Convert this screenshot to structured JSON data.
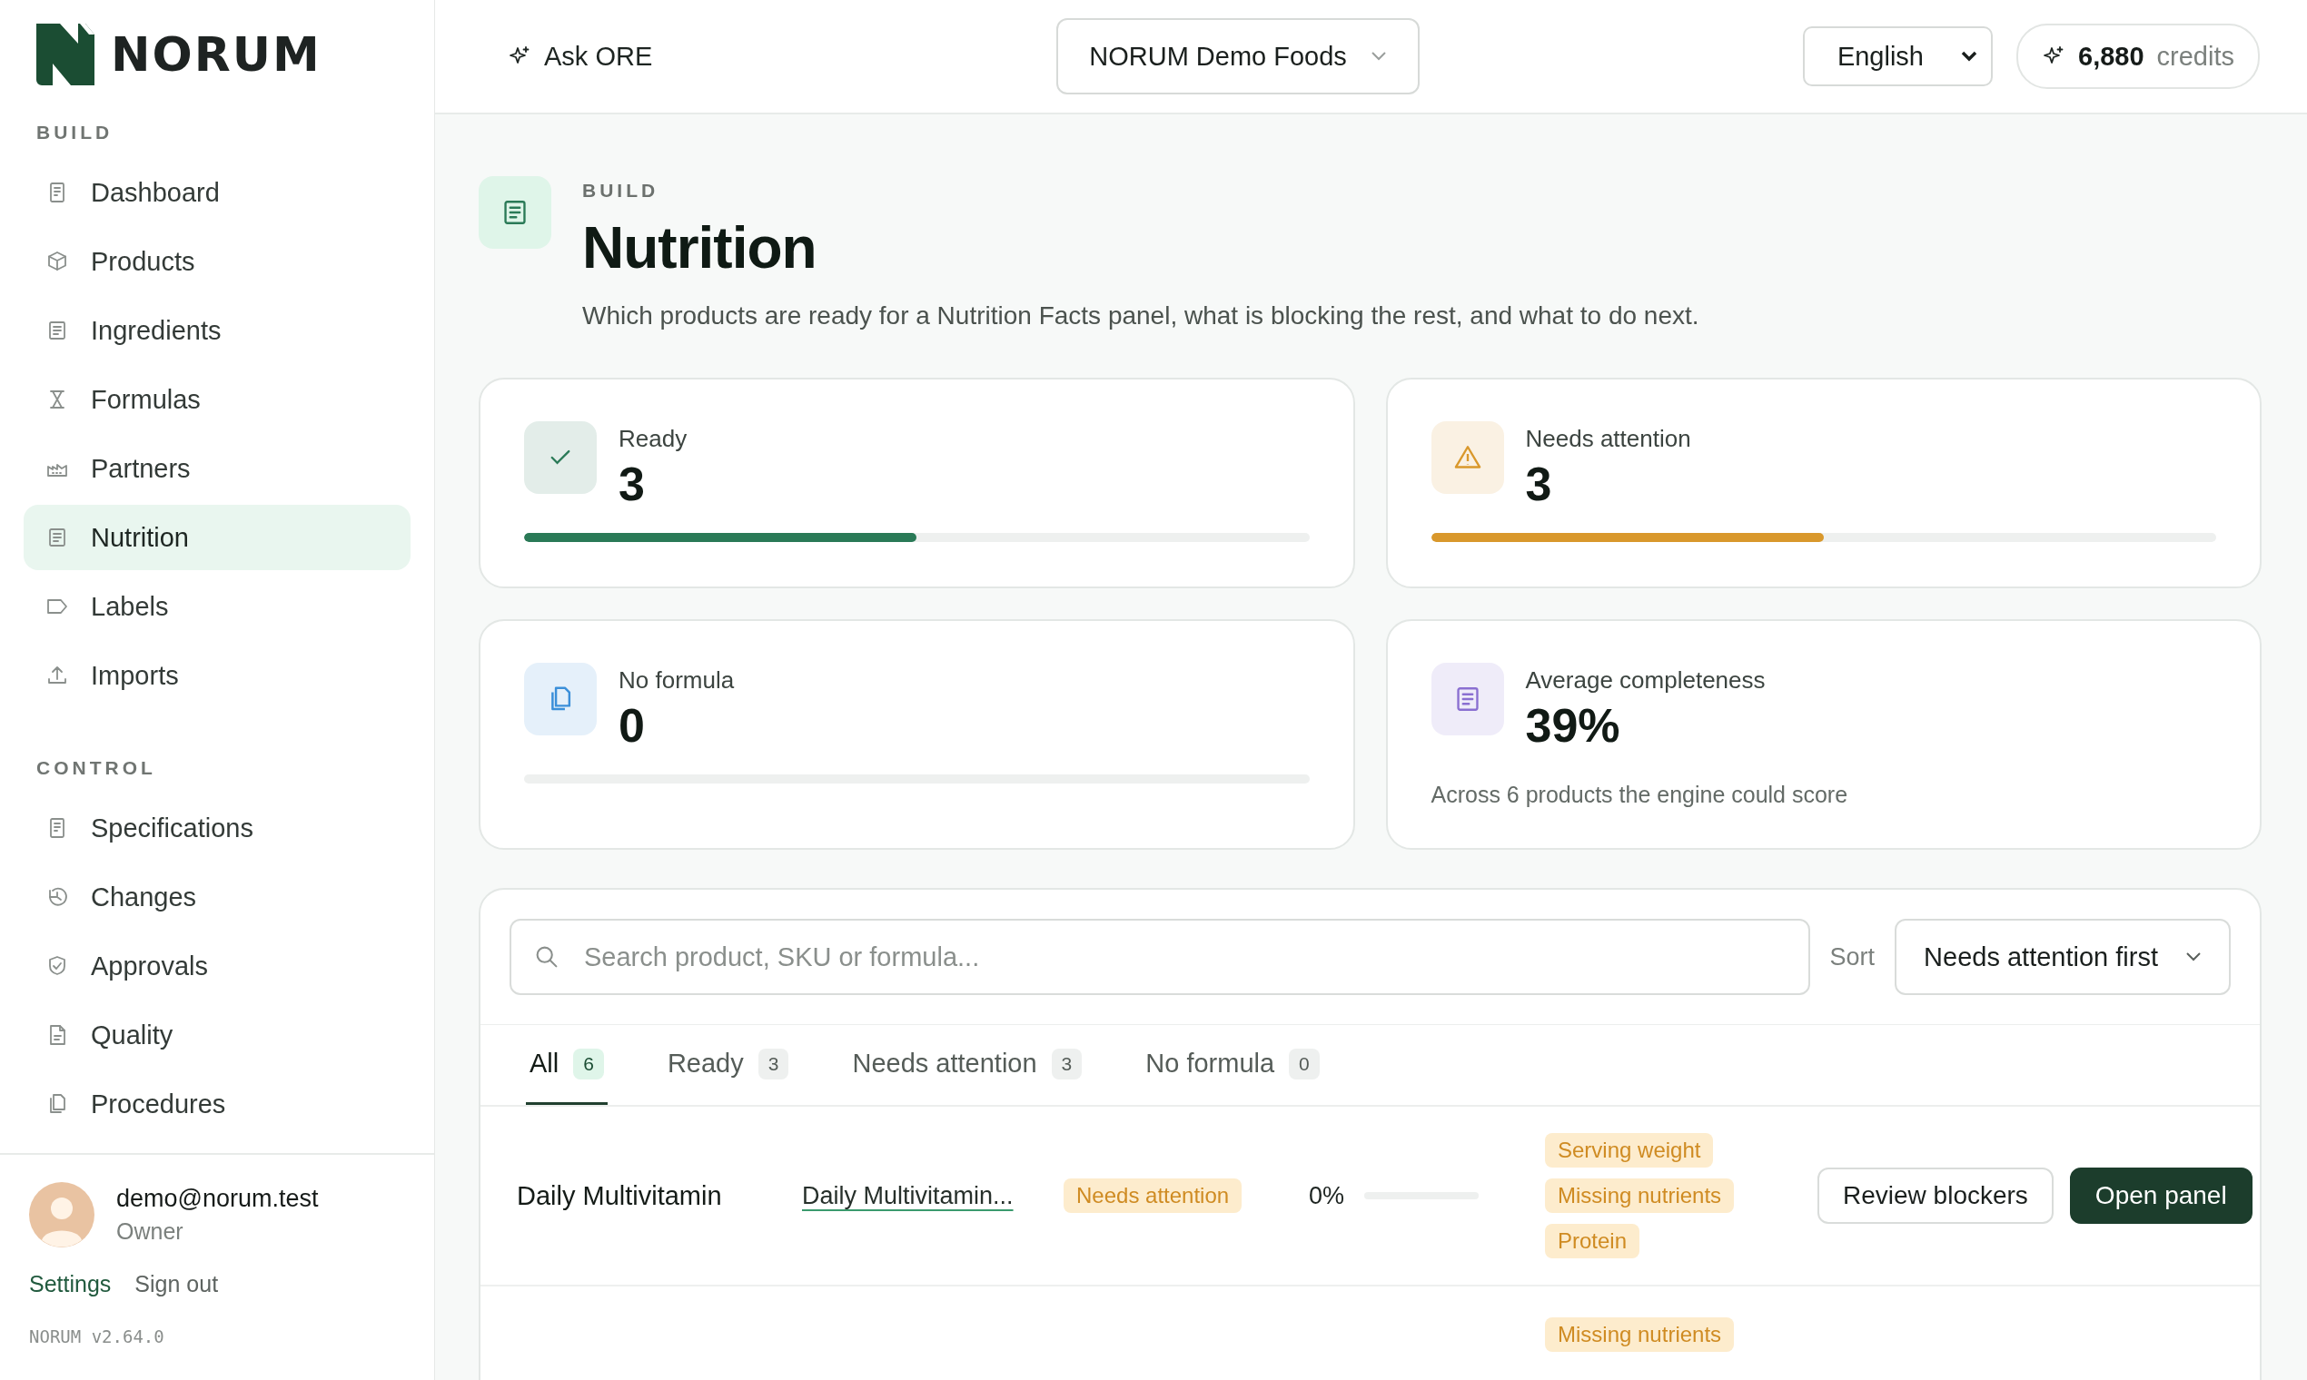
{
  "logo": {
    "text": "NORUM"
  },
  "sidebar": {
    "sections": [
      {
        "title": "BUILD",
        "items": [
          {
            "label": "Dashboard",
            "selected": false
          },
          {
            "label": "Products",
            "selected": false
          },
          {
            "label": "Ingredients",
            "selected": false
          },
          {
            "label": "Formulas",
            "selected": false
          },
          {
            "label": "Partners",
            "selected": false
          },
          {
            "label": "Nutrition",
            "selected": true
          },
          {
            "label": "Labels",
            "selected": false
          },
          {
            "label": "Imports",
            "selected": false
          }
        ]
      },
      {
        "title": "CONTROL",
        "items": [
          {
            "label": "Specifications",
            "selected": false
          },
          {
            "label": "Changes",
            "selected": false
          },
          {
            "label": "Approvals",
            "selected": false
          },
          {
            "label": "Quality",
            "selected": false
          },
          {
            "label": "Procedures",
            "selected": false
          }
        ]
      }
    ]
  },
  "user": {
    "email": "demo@norum.test",
    "role": "Owner",
    "links": [
      "Settings",
      "Sign out"
    ],
    "version": "NORUM v2.64.0"
  },
  "header": {
    "ask": "Ask ORE",
    "company": "NORUM Demo Foods",
    "language": "English",
    "credits": {
      "value": "6,880",
      "unit": "credits"
    }
  },
  "page": {
    "section": "BUILD",
    "title": "Nutrition",
    "subtitle": "Which products are ready for a Nutrition Facts panel, what is blocking the rest, and what to do next."
  },
  "stats": [
    {
      "kind": "meter",
      "label": "Ready",
      "value": "3",
      "color": "#2a7a57",
      "level": 0.5
    },
    {
      "kind": "meter",
      "label": "Needs attention",
      "value": "3",
      "color": "#d9982c",
      "level": 0.5
    },
    {
      "kind": "meter",
      "label": "No formula",
      "value": "0",
      "color": "#3b8fd9"
    },
    {
      "kind": "note",
      "label": "Average completeness",
      "value": "39%",
      "color": "#8a6fd1",
      "note": "Across 6 products the engine could score"
    }
  ],
  "search": {
    "placeholder": "Search product, SKU or formula..."
  },
  "sort": {
    "label": "Sort",
    "value": "Needs attention first"
  },
  "tabs": [
    {
      "label": "All",
      "count": "6",
      "selected": true
    },
    {
      "label": "Ready",
      "count": "3",
      "selected": false
    },
    {
      "label": "Needs attention",
      "count": "3",
      "selected": false
    },
    {
      "label": "No formula",
      "count": "0",
      "selected": false
    }
  ],
  "rows": [
    {
      "name": "Daily Multivitamin",
      "formula": "Daily Multivitamin...",
      "status": "Needs attention",
      "completeness": "0%",
      "blockers": [
        "Serving weight",
        "Missing nutrients",
        "Protein"
      ],
      "actions": [
        "Review blockers",
        "Open panel"
      ]
    },
    {
      "blockers": [
        "Missing nutrients"
      ]
    }
  ]
}
